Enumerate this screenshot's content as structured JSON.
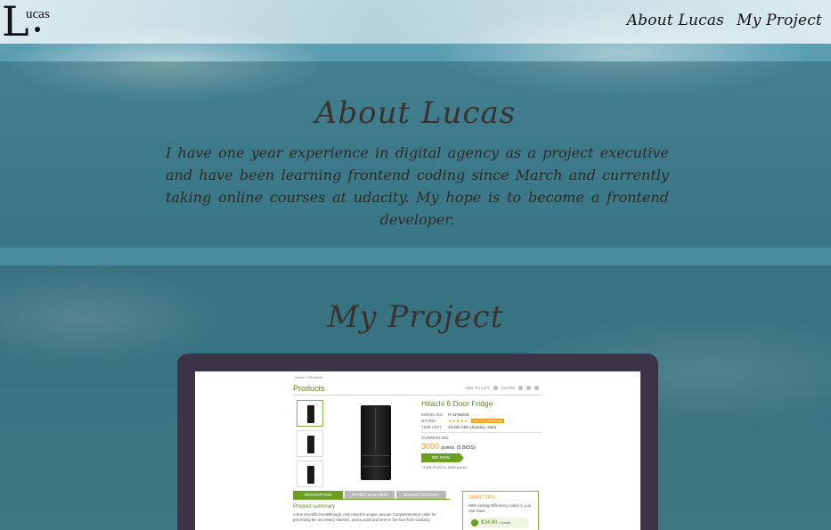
{
  "header": {
    "logo_initial": "L",
    "logo_rest": "ucas",
    "nav": [
      {
        "label": "About Lucas"
      },
      {
        "label": "My Project"
      }
    ]
  },
  "about": {
    "title": "About Lucas",
    "text": "I have one year experience in digital agency as a project executive and have been learning frontend coding since March and currently taking online courses at udacity. My hope is to become a frontend developer."
  },
  "project": {
    "title": "My Project",
    "preview": {
      "breadcrumb": "Home > Products",
      "page_title": "Products",
      "actions": [
        "ADD TO LIST",
        "SHARE"
      ],
      "product_name": "Hitachi 6 Door Fridge",
      "model_label": "MODEL NO",
      "model_value": "R-SF6800B",
      "rating_label": "RATING",
      "rating_stars": "★★★★★",
      "review_button": "WRITE A REVIEW",
      "time_label": "TIME LEFT",
      "time_value": "4d 20h 48m (Sunday, 3am)",
      "bid_label": "CURRENT BID",
      "bid_value": "3000",
      "bid_unit": "points",
      "bid_count": "(5 BIDS)",
      "bid_button": "BID NOW",
      "your_points": "YOUR POINTS: 8000 points",
      "tabs": [
        "DESCRIPTION",
        "RATING & REVIEW",
        "BIDDING HISTORY"
      ],
      "summary_title": "Product summary",
      "summary_text": "A true scientific breakthrough, only Hitachi's unique vacuum Compartments is cabie for preventing the necessary vitamins, amino acids and DHA in the food from oxidizing",
      "tips_title": "SMART TIPS",
      "tips_text": "With energy Efficiency Label 1, you can Save",
      "tips_price": "$14.90",
      "tips_price_unit": "/ month"
    }
  }
}
